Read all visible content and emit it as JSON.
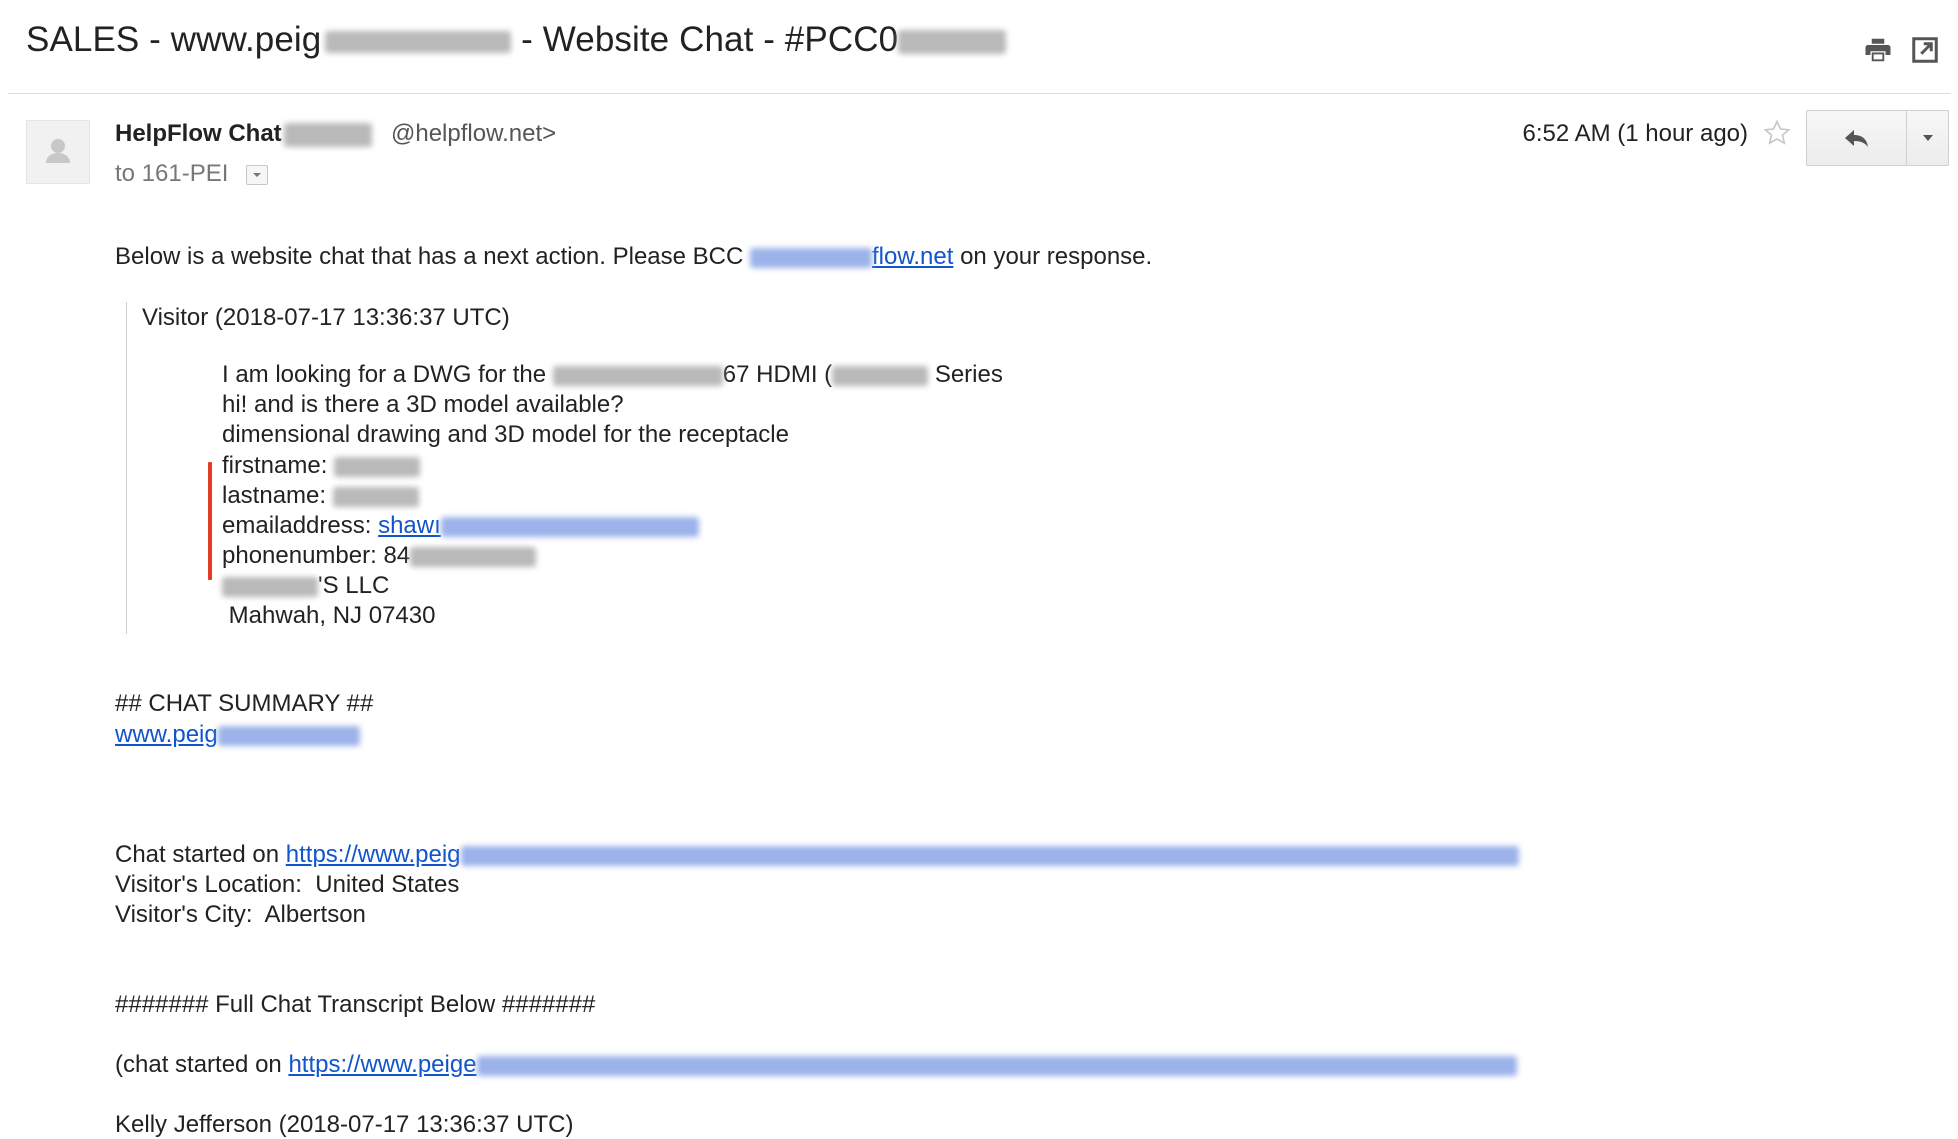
{
  "header": {
    "subject_part1": "SALES - www.peig",
    "subject_part2": " - Website Chat - #PCC0",
    "subject_part3": "",
    "print_icon": "print-icon",
    "popout_icon": "open-in-new-window-icon"
  },
  "sender": {
    "name": "HelpFlow Chat",
    "email_visible": "@helpflow.net>",
    "to_label": "to 161-PEI",
    "time": "6:52 AM (1 hour ago)",
    "avatar_icon": "person-icon",
    "star_icon": "star-outline-icon",
    "reply_icon": "reply-icon",
    "more_icon": "chevron-down-icon"
  },
  "message": {
    "intro_before": "Below is a website chat that has a next action. Please BCC ",
    "intro_link_visible": "flow.net",
    "intro_after": " on your response.",
    "visitor_header": "Visitor (2018-07-17 13:36:37 UTC)",
    "line1_a": "I am looking for a DWG for the ",
    "line1_b": "67 HDMI (",
    "line1_c": " Series",
    "line2": "hi! and is there a 3D model available?",
    "line3": "dimensional drawing and 3D model for the receptacle",
    "firstname_label": "firstname: ",
    "lastname_label": "lastname: ",
    "email_label": "emailaddress: ",
    "email_link_visible": "shawı",
    "phone_label": "phonenumber: 84",
    "company_suffix": "'S LLC",
    "city_line": " Mahwah, NJ 07430",
    "summary_heading": "## CHAT SUMMARY ##",
    "summary_link_visible": "www.peig",
    "chat_started_label": "Chat started on ",
    "chat_started_link": "https://www.peig",
    "visitor_location": "Visitor's Location:  United States",
    "visitor_city": "Visitor's City:  Albertson",
    "transcript_heading": "####### Full Chat Transcript Below #######",
    "transcript_started_label": "(chat started on ",
    "transcript_started_link": "https://www.peige",
    "agent_line": "Kelly Jefferson (2018-07-17 13:36:37 UTC)"
  },
  "colors": {
    "link": "#1155cc",
    "annotation_red": "#e53a26",
    "text": "#222222"
  }
}
